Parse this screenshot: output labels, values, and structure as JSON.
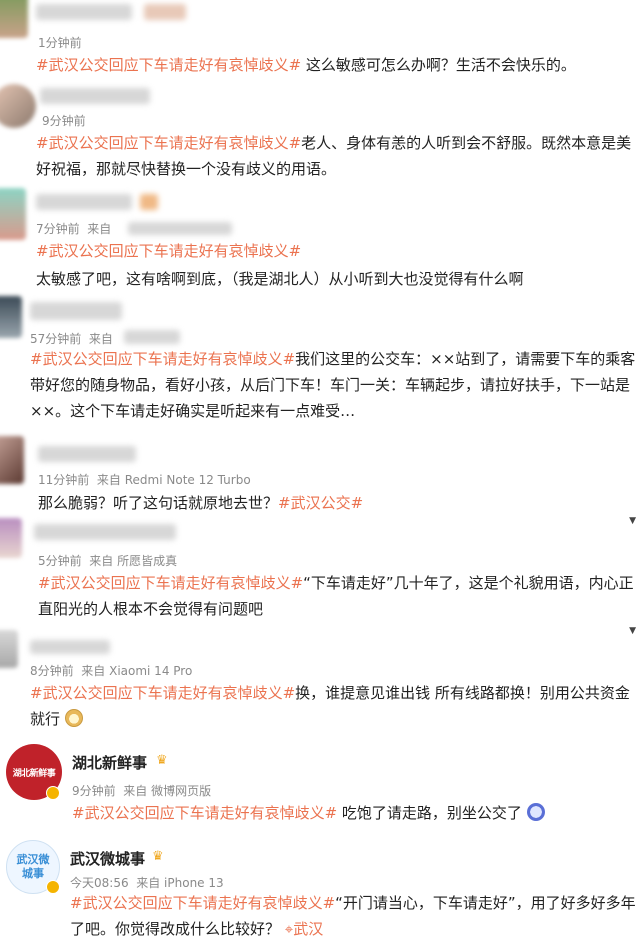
{
  "comments": [
    {
      "time": "1分钟前",
      "tag": "#武汉公交回应下车请走好有哀悼歧义#",
      "text": " 这么敏感可怎么办啊？生活不会快乐的。"
    },
    {
      "time": "9分钟前",
      "tag": "#武汉公交回应下车请走好有哀悼歧义#",
      "text": "老人、身体有恙的人听到会不舒服。既然本意是美好祝福，那就尽快替换一个没有歧义的用语。"
    },
    {
      "time": "7分钟前",
      "source": "来自",
      "tag": "#武汉公交回应下车请走好有哀悼歧义#",
      "text": "太敏感了吧，这有啥啊到底，（我是湖北人）从小听到大也没觉得有什么啊"
    },
    {
      "time": "57分钟前",
      "source": "来自",
      "tag": "#武汉公交回应下车请走好有哀悼歧义#",
      "text": "我们这里的公交车：××站到了，请需要下车的乘客带好您的随身物品，看好小孩，从后门下车！车门一关：车辆起步，请拉好扶手，下一站是××。这个下车请走好确实是听起来有一点难受…"
    },
    {
      "time": "11分钟前",
      "source": "来自 Redmi Note 12 Turbo",
      "text": "那么脆弱？听了这句话就原地去世？",
      "tag": "#武汉公交#"
    },
    {
      "time": "5分钟前",
      "source": "来自 所愿皆成真",
      "tag": "#武汉公交回应下车请走好有哀悼歧义#",
      "text": "“下车请走好”几十年了，这是个礼貌用语，内心正直阳光的人根本不会觉得有问题吧"
    },
    {
      "time": "8分钟前",
      "source": "来自 Xiaomi 14 Pro",
      "tag": "#武汉公交回应下车请走好有哀悼歧义#",
      "text": "换，谁提意见谁出钱 所有线路都换！别用公共资金就行"
    },
    {
      "name": "湖北新鲜事",
      "avatar_text": "湖北新鲜事",
      "time": "9分钟前",
      "source": "来自 微博网页版",
      "tag": "#武汉公交回应下车请走好有哀悼歧义#",
      "text": " 吃饱了请走路，别坐公交了"
    },
    {
      "name": "武汉微城事",
      "avatar_text": "武汉微城事",
      "time": "今天08:56",
      "source": "来自 iPhone 13",
      "tag": "#武汉公交回应下车请走好有哀悼歧义#",
      "text": "“开门请当心，下车请走好”，用了好多好多年了吧。你觉得改成什么比较好？",
      "location": "武汉"
    }
  ],
  "colors": {
    "tag": "#eb7350",
    "meta": "#8a8a8a",
    "text": "#222222"
  }
}
